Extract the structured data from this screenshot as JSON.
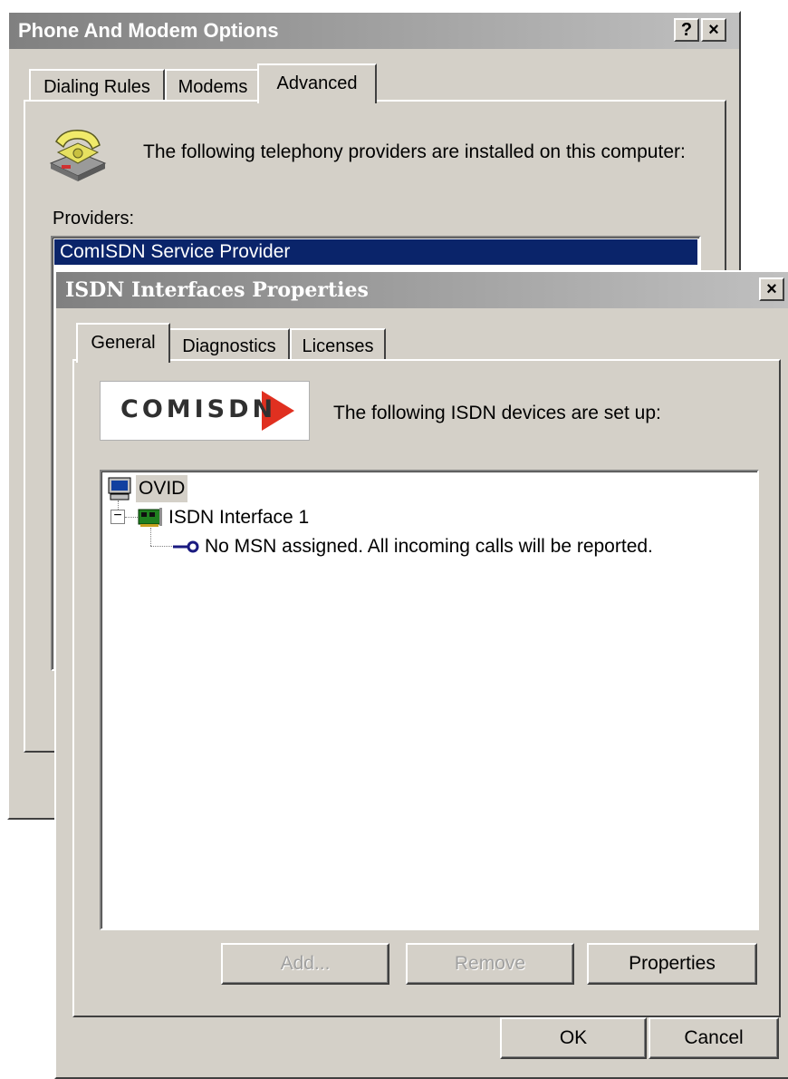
{
  "back_dialog": {
    "title": "Phone And Modem Options",
    "tabs": [
      "Dialing Rules",
      "Modems",
      "Advanced"
    ],
    "description": "The following telephony providers are installed on this computer:",
    "providers_label": "Providers:",
    "providers": [
      "ComISDN Service Provider"
    ],
    "help_glyph": "?",
    "close_glyph": "×"
  },
  "front_dialog": {
    "title": "ISDN Interfaces Properties",
    "close_glyph": "×",
    "tabs": [
      "General",
      "Diagnostics",
      "Licenses"
    ],
    "logo_text": "COMISDN",
    "description": "The following ISDN devices are set up:",
    "tree": {
      "root": "OVID",
      "child": "ISDN Interface 1",
      "grandchild": "No MSN assigned. All incoming calls will be reported.",
      "expander": "−"
    },
    "buttons": {
      "add": "Add...",
      "remove": "Remove",
      "properties": "Properties"
    },
    "ok": "OK",
    "cancel": "Cancel"
  },
  "colors": {
    "face": "#d4d0c8",
    "selection": "#0a246a",
    "inactive_title_start": "#808080",
    "inactive_title_end": "#c0c0c0",
    "logo_red": "#e03020"
  }
}
